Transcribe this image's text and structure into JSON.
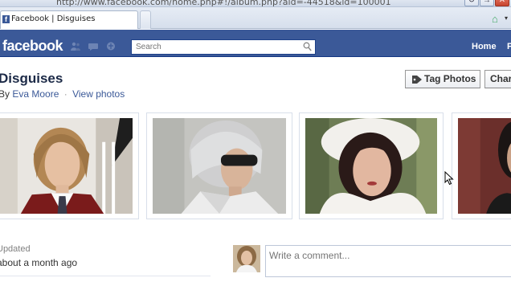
{
  "browser": {
    "url": "http://www.facebook.com/home.php#!/album.php?aid=-44518&id=100001",
    "tab_title": "Facebook | Disguises",
    "tab_favicon": "f"
  },
  "header": {
    "logo": "facebook",
    "search": {
      "placeholder": "Search",
      "value": ""
    },
    "nav": [
      "Home",
      "P"
    ],
    "jewels": [
      "friend-requests-icon",
      "messages-icon",
      "notifications-icon"
    ]
  },
  "album": {
    "title": "Disguises",
    "by_prefix": "By",
    "author": "Eva Moore",
    "separator": "·",
    "view_photos": "View photos",
    "tag_photos_label": "Tag Photos",
    "share_label_partial": "Char"
  },
  "photos": [
    {
      "name": "photo-1",
      "subject": "woman-in-uniform"
    },
    {
      "name": "photo-2",
      "subject": "woman-silver-hair-sunglasses"
    },
    {
      "name": "photo-3",
      "subject": "woman-white-fur-hat"
    },
    {
      "name": "photo-4",
      "subject": "woman-dark-hair"
    }
  ],
  "meta": {
    "updated_label": "Updated",
    "updated_value": "about a month ago"
  },
  "comment": {
    "placeholder": "Write a comment..."
  },
  "colors": {
    "fb_blue": "#3b5998",
    "link": "#3b5998",
    "border": "#d8dfea"
  }
}
